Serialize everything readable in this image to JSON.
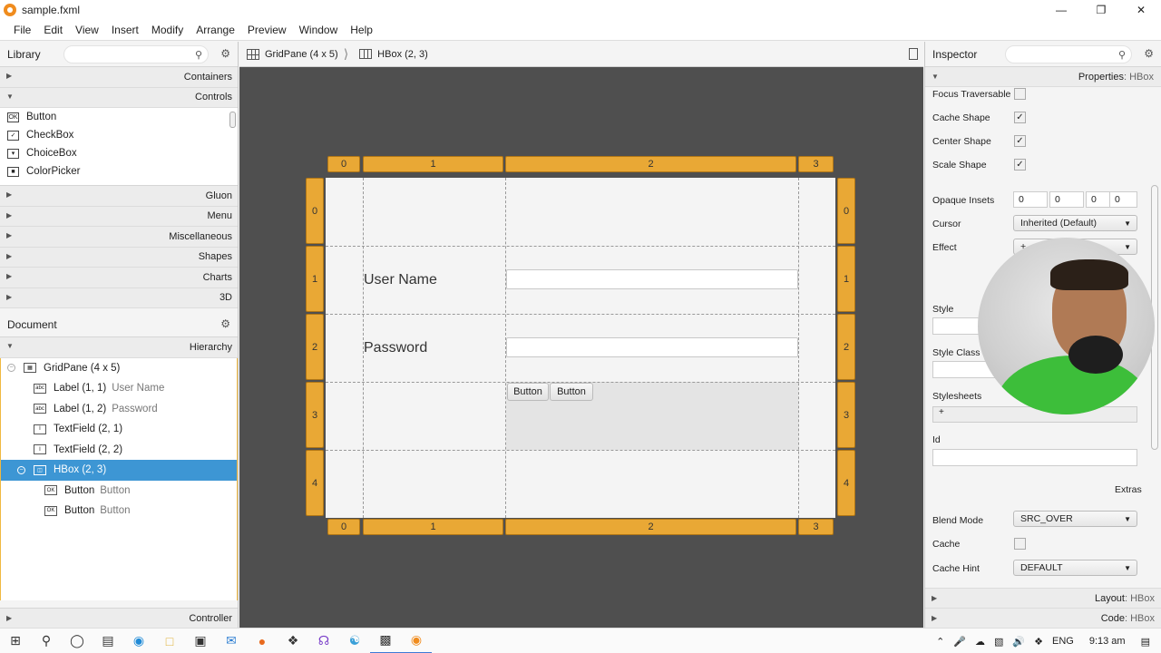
{
  "window": {
    "title": "sample.fxml"
  },
  "menu": [
    "File",
    "Edit",
    "View",
    "Insert",
    "Modify",
    "Arrange",
    "Preview",
    "Window",
    "Help"
  ],
  "library": {
    "title": "Library",
    "sections_top": [
      "Containers",
      "Controls"
    ],
    "controls": [
      "Button",
      "CheckBox",
      "ChoiceBox",
      "ColorPicker"
    ],
    "sections_bottom": [
      "Gluon",
      "Menu",
      "Miscellaneous",
      "Shapes",
      "Charts",
      "3D"
    ]
  },
  "document": {
    "title": "Document",
    "hierarchy_label": "Hierarchy",
    "tree": [
      {
        "label": "GridPane (4 x 5)",
        "sub": ""
      },
      {
        "label": "Label (1, 1)",
        "sub": "User Name"
      },
      {
        "label": "Label (1, 2)",
        "sub": "Password"
      },
      {
        "label": "TextField (2, 1)",
        "sub": ""
      },
      {
        "label": "TextField (2, 2)",
        "sub": ""
      },
      {
        "label": "HBox (2, 3)",
        "sub": ""
      },
      {
        "label": "Button",
        "sub": "Button"
      },
      {
        "label": "Button",
        "sub": "Button"
      }
    ],
    "controller_label": "Controller"
  },
  "breadcrumb": {
    "first": "GridPane (4 x 5)",
    "second": "HBox (2, 3)"
  },
  "canvas": {
    "col_headers": [
      "0",
      "1",
      "2",
      "3"
    ],
    "row_headers": [
      "0",
      "1",
      "2",
      "3",
      "4"
    ],
    "label_user": "User Name",
    "label_pass": "Password",
    "button1": "Button",
    "button2": "Button"
  },
  "inspector": {
    "title": "Inspector",
    "properties_label": "Properties",
    "properties_sub": " : HBox",
    "focus_traversable": "Focus Traversable",
    "cache_shape": "Cache Shape",
    "center_shape": "Center Shape",
    "scale_shape": "Scale Shape",
    "opaque_insets": "Opaque Insets",
    "insets": [
      "0",
      "0",
      "0",
      "0"
    ],
    "cursor": "Cursor",
    "cursor_value": "Inherited (Default)",
    "effect": "Effect",
    "effect_value": "+",
    "style": "Style",
    "style_class": "Style Class",
    "stylesheets": "Stylesheets",
    "stylesheets_value": "+",
    "id": "Id",
    "extras": "Extras",
    "blend_mode": "Blend Mode",
    "blend_mode_value": "SRC_OVER",
    "cache": "Cache",
    "cache_hint": "Cache Hint",
    "cache_hint_value": "DEFAULT",
    "layout_label": "Layout",
    "layout_sub": " : HBox",
    "code_label": "Code",
    "code_sub": " : HBox"
  },
  "taskbar": {
    "lang": "ENG",
    "time": "9:13 am"
  }
}
